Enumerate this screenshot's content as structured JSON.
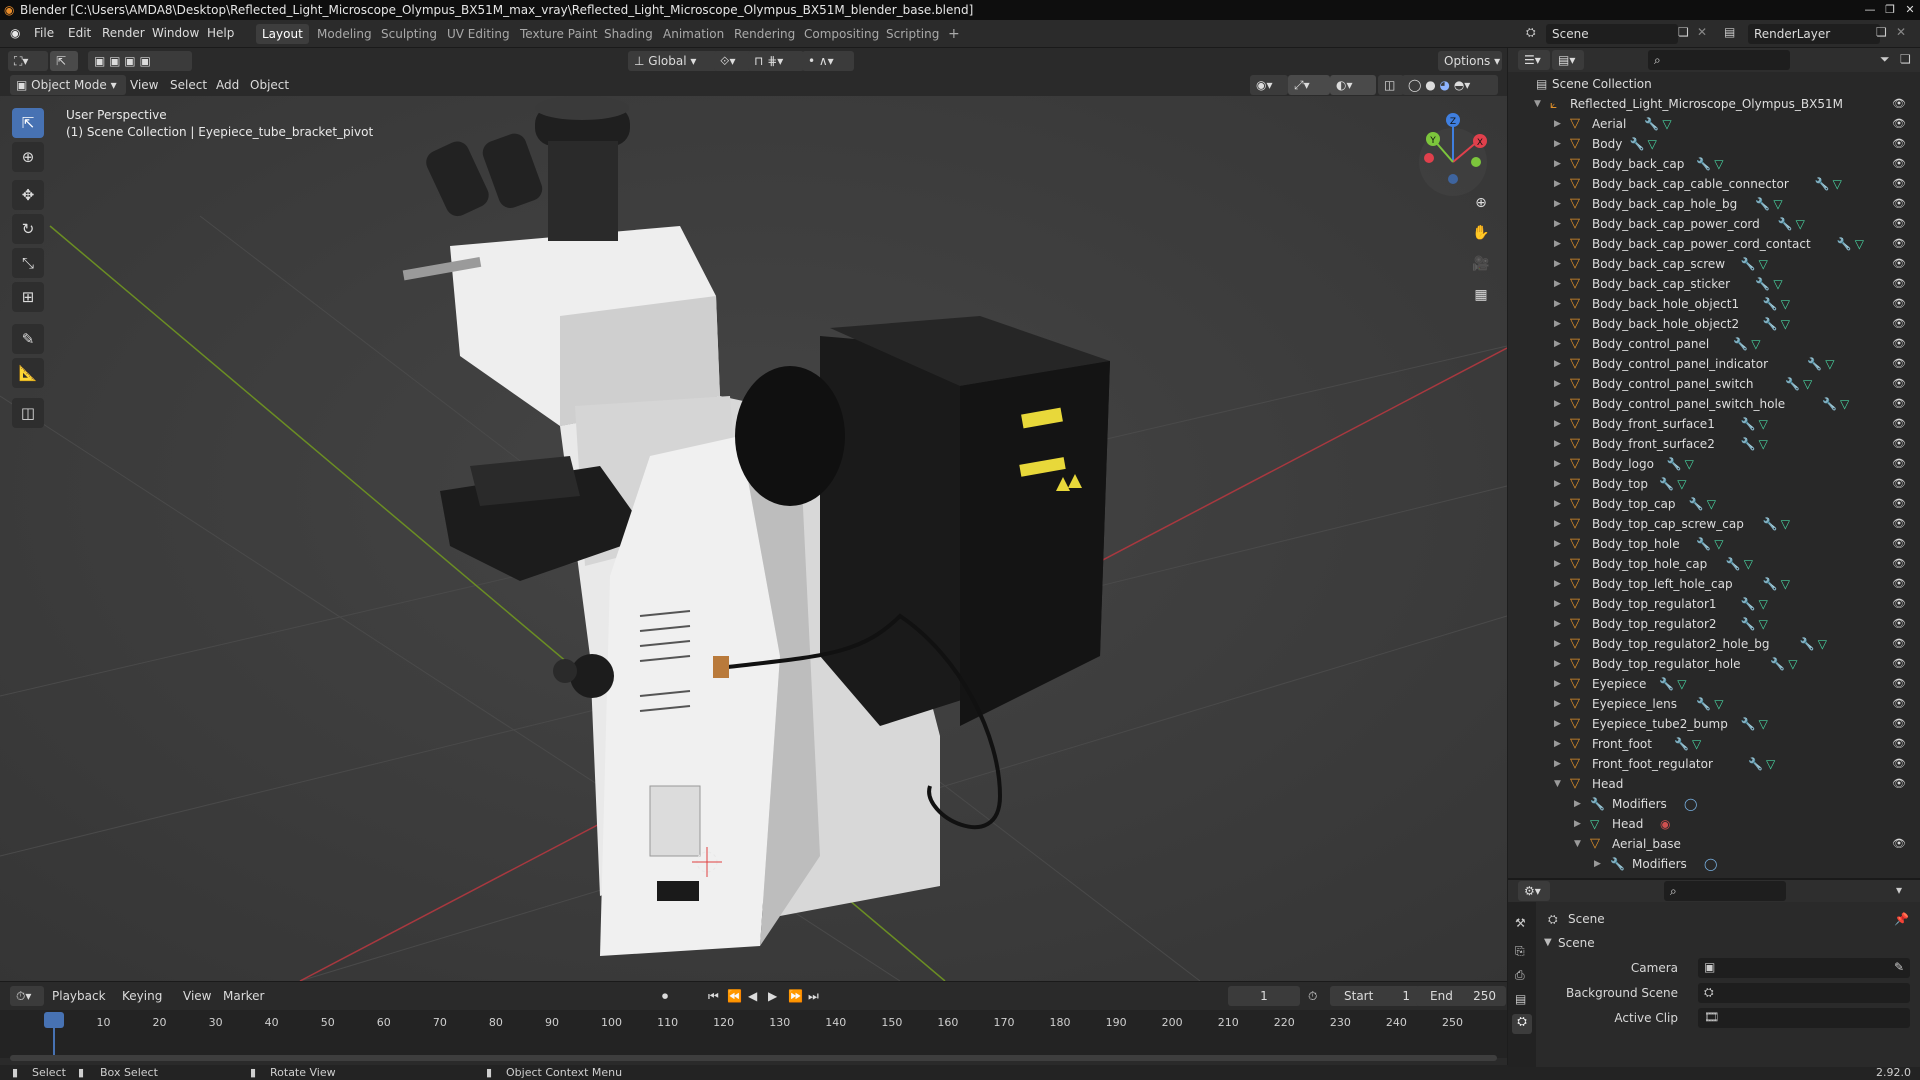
{
  "window": {
    "title": "Blender [C:\\Users\\AMDA8\\Desktop\\Reflected_Light_Microscope_Olympus_BX51M_max_vray\\Reflected_Light_Microscope_Olympus_BX51M_blender_base.blend]"
  },
  "menu": {
    "items": [
      "File",
      "Edit",
      "Render",
      "Window",
      "Help"
    ]
  },
  "workspaces": [
    "Layout",
    "Modeling",
    "Sculpting",
    "UV Editing",
    "Texture Paint",
    "Shading",
    "Animation",
    "Rendering",
    "Compositing",
    "Scripting"
  ],
  "scene_selector": {
    "label": "Scene",
    "value": "Scene"
  },
  "view_layer": {
    "value": "RenderLayer"
  },
  "viewport_header": {
    "mode": "Object Mode",
    "menus": [
      "View",
      "Select",
      "Add",
      "Object"
    ],
    "transform_orientation": "Global",
    "options_label": "Options"
  },
  "viewport": {
    "perspective_label": "User Perspective",
    "context_label": "(1) Scene Collection | Eyepiece_tube_bracket_pivot",
    "gizmo": {
      "x": "X",
      "y": "Y",
      "z": "Z"
    }
  },
  "timeline": {
    "menus": [
      "Playback",
      "Keying",
      "View",
      "Marker"
    ],
    "current_frame": "1",
    "start_label": "Start",
    "start": "1",
    "end_label": "End",
    "end": "250",
    "ticks": [
      "1",
      "10",
      "20",
      "30",
      "40",
      "50",
      "60",
      "70",
      "80",
      "90",
      "100",
      "110",
      "120",
      "130",
      "140",
      "150",
      "160",
      "170",
      "180",
      "190",
      "200",
      "210",
      "220",
      "230",
      "240",
      "250"
    ]
  },
  "status": {
    "select": "Select",
    "box_select": "Box Select",
    "rotate_view": "Rotate View",
    "context_menu": "Object Context Menu",
    "version": "2.92.0"
  },
  "outliner": {
    "root": "Scene Collection",
    "collection": "Reflected_Light_Microscope_Olympus_BX51M",
    "objects": [
      "Aerial",
      "Body",
      "Body_back_cap",
      "Body_back_cap_cable_connector",
      "Body_back_cap_hole_bg",
      "Body_back_cap_power_cord",
      "Body_back_cap_power_cord_contact",
      "Body_back_cap_screw",
      "Body_back_cap_sticker",
      "Body_back_hole_object1",
      "Body_back_hole_object2",
      "Body_control_panel",
      "Body_control_panel_indicator",
      "Body_control_panel_switch",
      "Body_control_panel_switch_hole",
      "Body_front_surface1",
      "Body_front_surface2",
      "Body_logo",
      "Body_top",
      "Body_top_cap",
      "Body_top_cap_screw_cap",
      "Body_top_hole",
      "Body_top_hole_cap",
      "Body_top_left_hole_cap",
      "Body_top_regulator1",
      "Body_top_regulator2",
      "Body_top_regulator2_hole_bg",
      "Body_top_regulator_hole",
      "Eyepiece",
      "Eyepiece_lens",
      "Eyepiece_tube2_bump",
      "Front_foot",
      "Front_foot_regulator"
    ],
    "head": "Head",
    "head_children": {
      "modifiers": "Modifiers",
      "mesh": "Head",
      "aerial_base": "Aerial_base",
      "aerial_modifiers": "Modifiers"
    }
  },
  "properties": {
    "header": "Scene",
    "panel": "Scene",
    "fields": [
      "Camera",
      "Background Scene",
      "Active Clip"
    ]
  },
  "colors": {
    "accent": "#4772b3",
    "object_icon": "#e0902a",
    "mesh_icon": "#49d3a0",
    "modifier_icon": "#7bb4e6",
    "axis_x": "#e0404c",
    "axis_y": "#7cc53c",
    "axis_z": "#3f7fe0",
    "playhead": "#4772b3"
  }
}
